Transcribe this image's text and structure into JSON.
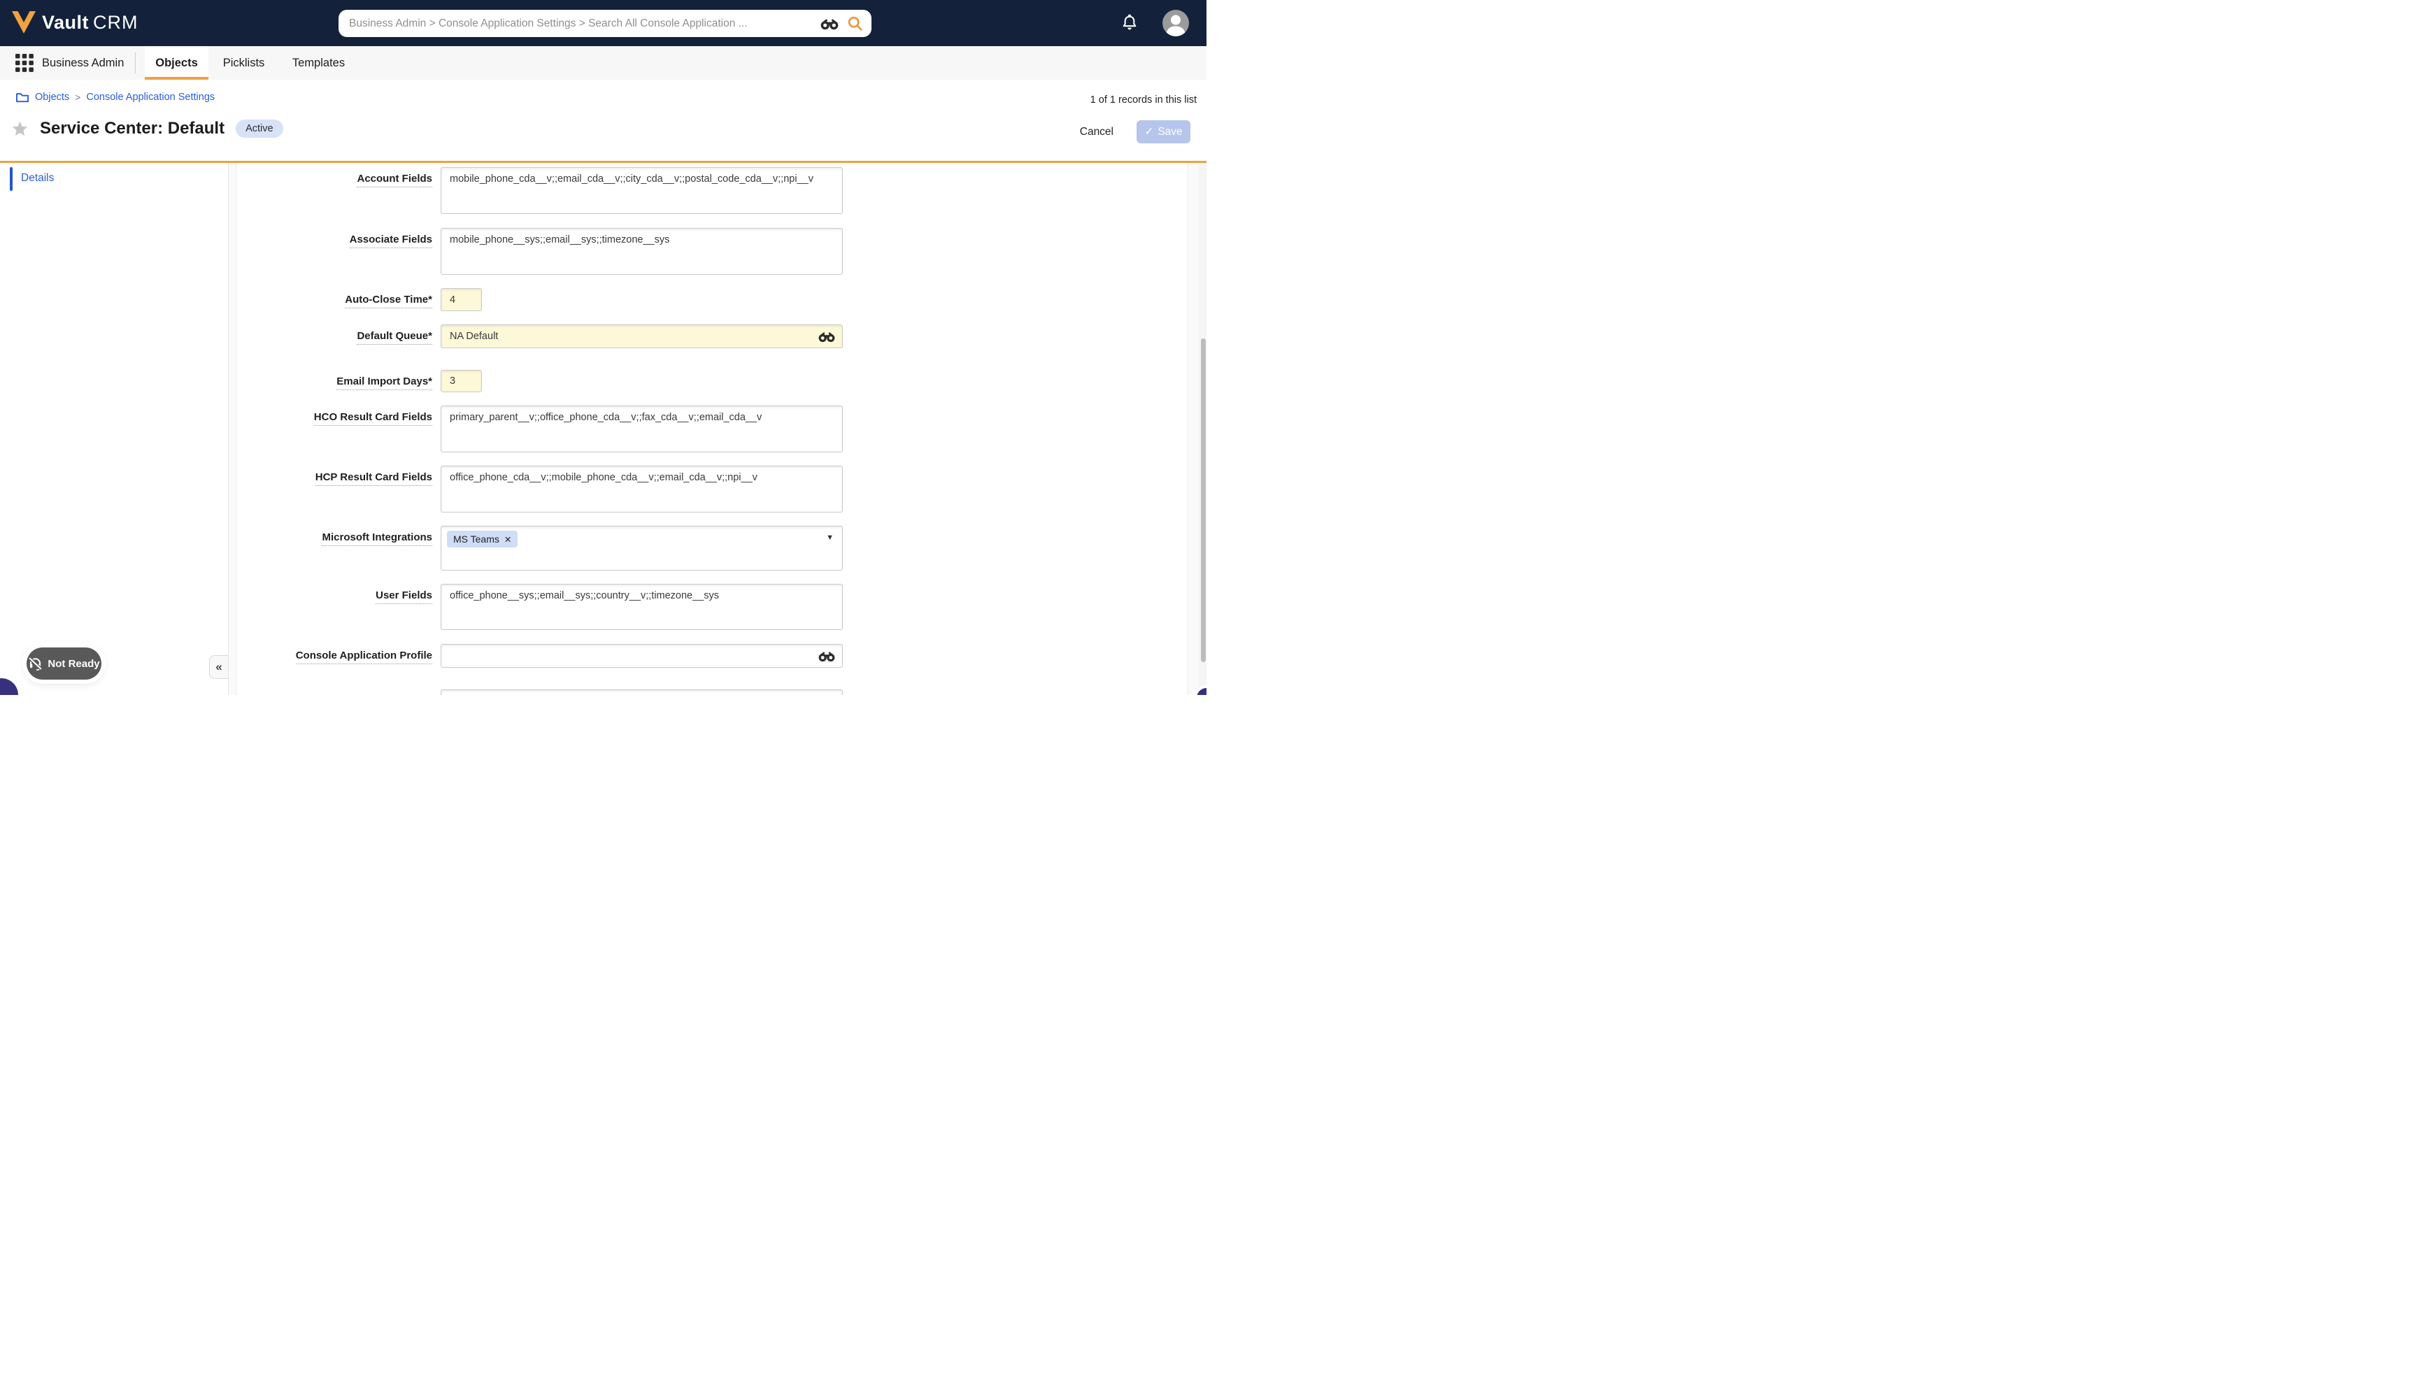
{
  "brand": {
    "name_bold": "Vault",
    "name_light": "CRM"
  },
  "search": {
    "placeholder": "Business Admin > Console Application Settings > Search All Console Application ..."
  },
  "nav": {
    "app_menu_label": "Business Admin",
    "tabs": [
      {
        "label": "Objects",
        "active": true
      },
      {
        "label": "Picklists",
        "active": false
      },
      {
        "label": "Templates",
        "active": false
      }
    ]
  },
  "breadcrumb": {
    "links": [
      "Objects",
      "Console Application Settings"
    ],
    "separator": ">"
  },
  "list_info": {
    "record_count": "1 of 1 records in this list"
  },
  "record_header": {
    "title": "Service Center: Default",
    "status_badge": "Active",
    "cancel_label": "Cancel",
    "save_label": "Save",
    "save_check": "✓"
  },
  "sidebar": {
    "items": [
      {
        "label": "Details",
        "active": true
      }
    ]
  },
  "form": {
    "fields": [
      {
        "label": "Account Fields",
        "kind": "textarea",
        "value": "mobile_phone_cda__v;;email_cda__v;;city_cda__v;;postal_code_cda__v;;npi__v"
      },
      {
        "label": "Associate Fields",
        "kind": "textarea",
        "value": "mobile_phone__sys;;email__sys;;timezone__sys"
      },
      {
        "label": "Auto-Close Time*",
        "kind": "short",
        "required": true,
        "value": "4"
      },
      {
        "label": "Default Queue*",
        "kind": "lookup",
        "required": true,
        "value": "NA Default"
      },
      {
        "label": "Email Import Days*",
        "kind": "short",
        "required": true,
        "value": "3"
      },
      {
        "label": "HCO Result Card Fields",
        "kind": "textarea",
        "value": "primary_parent__v;;office_phone_cda__v;;fax_cda__v;;email_cda__v"
      },
      {
        "label": "HCP Result Card Fields",
        "kind": "textarea",
        "value": "office_phone_cda__v;;mobile_phone_cda__v;;email_cda__v;;npi__v"
      },
      {
        "label": "Microsoft Integrations",
        "kind": "multiselect",
        "chips": [
          {
            "label": "MS Teams"
          }
        ]
      },
      {
        "label": "User Fields",
        "kind": "textarea",
        "value": "office_phone__sys;;email__sys;;country__v;;timezone__sys"
      },
      {
        "label": "Console Application Profile",
        "kind": "lookup",
        "value": ""
      }
    ]
  },
  "status_widget": {
    "label": "Not Ready"
  },
  "panel_collapse": {
    "icon": "«"
  },
  "icons": {
    "chip_close": "✕",
    "dropdown_caret": "▼"
  },
  "colors": {
    "topbar_navy": "#13223A",
    "accent_orange": "#EFA03F",
    "link_blue": "#2B5CD9",
    "required_yellow": "#FCF8D8",
    "badge_blue": "#D8E2F7",
    "save_disabled_blue": "#B6C5EC",
    "chip_blue": "#CFDDF6",
    "notready_gray": "#595959"
  }
}
